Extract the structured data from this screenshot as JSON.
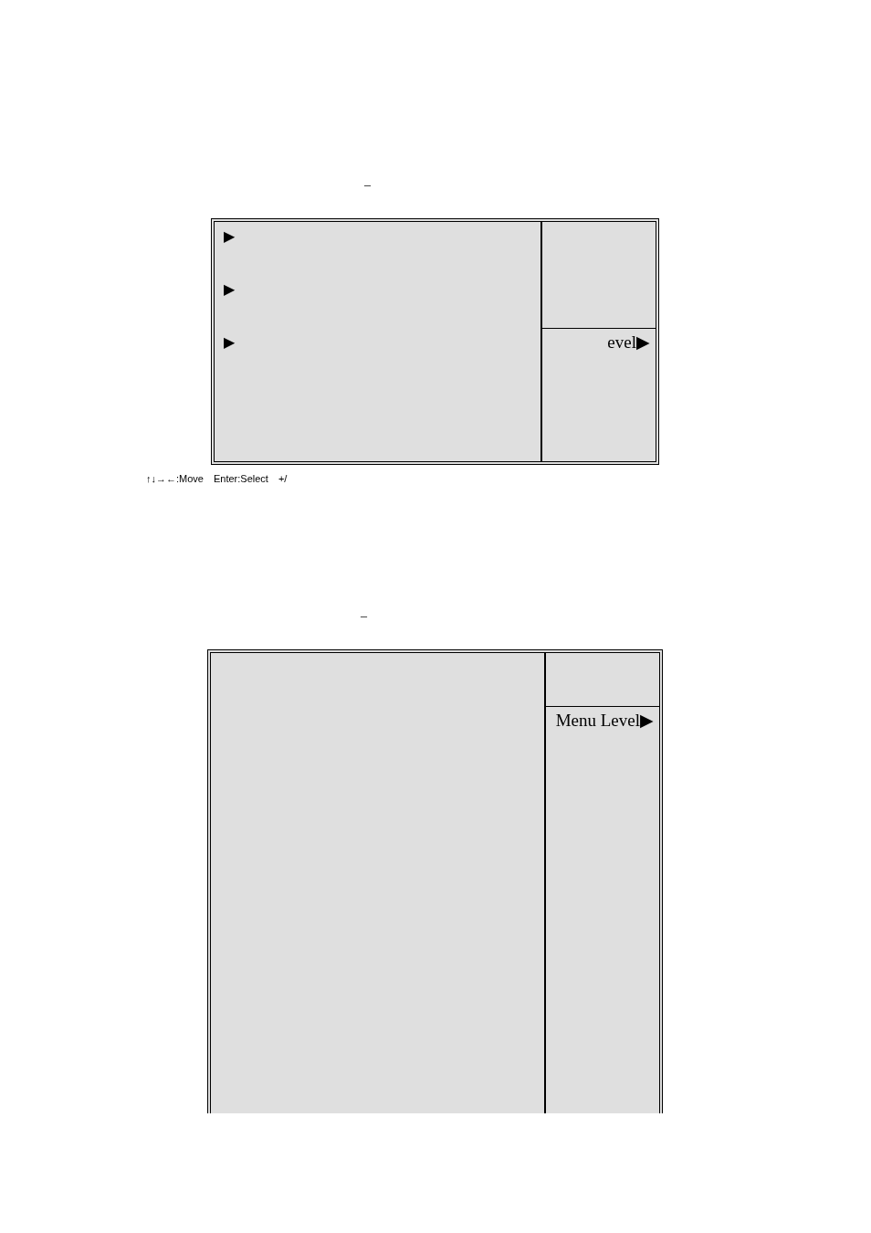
{
  "screens": [
    {
      "title": "–",
      "menu_items": [
        "▶",
        "▶",
        "▶"
      ],
      "help_text": "evel▶",
      "key_help": [
        "↑↓→←:Move",
        "Enter:Select",
        "+/"
      ]
    },
    {
      "title": "–",
      "help_text": "Menu Level▶"
    }
  ]
}
